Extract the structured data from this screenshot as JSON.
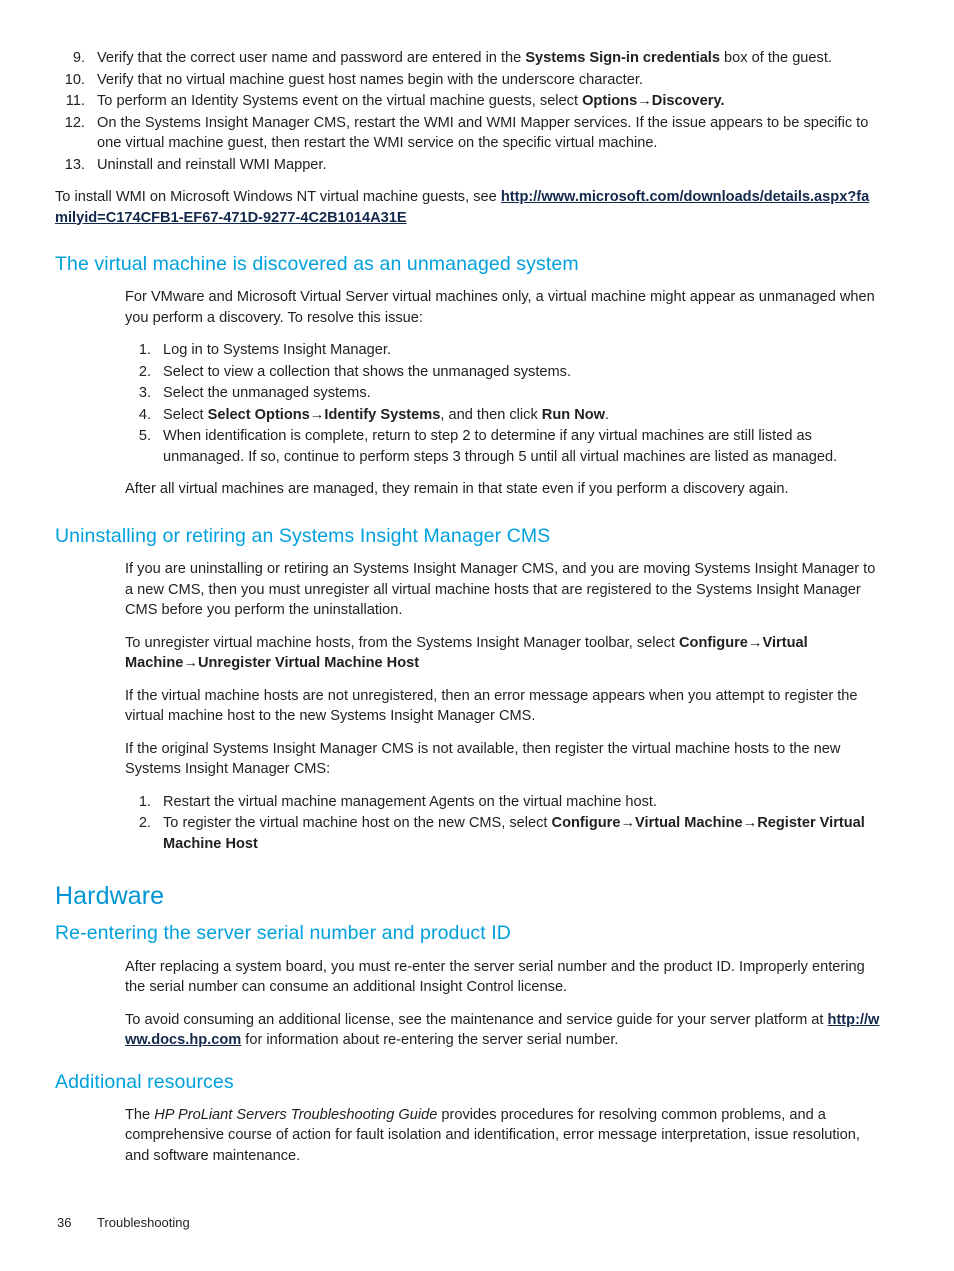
{
  "page": {
    "footer": {
      "page_number": "36",
      "chapter_label": "Troubleshooting"
    },
    "colors": {
      "heading_blue": "#0096D6",
      "subheading_blue": "#00A0DD",
      "link_navy": "#13294B",
      "body_text": "#231F20"
    }
  },
  "top_list": {
    "items": [
      {
        "num": "9.",
        "pre": "Verify that the correct user name and password are entered in the ",
        "bold": "Systems Sign-in credentials",
        "post": " box of the guest."
      },
      {
        "num": "10.",
        "pre": "Verify that no virtual machine guest host names begin with the underscore character.",
        "bold": "",
        "post": ""
      },
      {
        "num": "11.",
        "pre": "To perform an Identity Systems event on the virtual machine guests, select ",
        "bold": "Options→Discovery.",
        "post": ""
      },
      {
        "num": "12.",
        "pre": "On the Systems Insight Manager CMS, restart the WMI and WMI Mapper services. If the issue appears to be specific to one virtual machine guest, then restart the WMI service on the specific virtual machine.",
        "bold": "",
        "post": ""
      },
      {
        "num": "13.",
        "pre": "Uninstall and reinstall WMI Mapper.",
        "bold": "",
        "post": ""
      }
    ],
    "trailing_paragraph": {
      "pre": "To install WMI on Microsoft Windows NT virtual machine guests, see ",
      "link": "http://www.microsoft.com/downloads/details.aspx?familyid=C174CFB1-EF67-471D-9277-4C2B1014A31E"
    }
  },
  "section_unmanaged": {
    "heading": "The virtual machine is discovered as an unmanaged system",
    "intro": "For VMware and Microsoft Virtual Server virtual machines only, a virtual machine might appear as unmanaged when you perform a discovery. To resolve this issue:",
    "steps": [
      {
        "num": "1.",
        "pre": "Log in to Systems Insight Manager.",
        "bold": "",
        "mid": "",
        "bold2": "",
        "post": ""
      },
      {
        "num": "2.",
        "pre": "Select to view a collection that shows the unmanaged systems.",
        "bold": "",
        "mid": "",
        "bold2": "",
        "post": ""
      },
      {
        "num": "3.",
        "pre": "Select the unmanaged systems.",
        "bold": "",
        "mid": "",
        "bold2": "",
        "post": ""
      },
      {
        "num": "4.",
        "pre": "Select ",
        "bold": "Select Options→Identify Systems",
        "mid": ", and then click ",
        "bold2": "Run Now",
        "post": "."
      },
      {
        "num": "5.",
        "pre": "When identification is complete, return to step 2 to determine if any virtual machines are still listed as unmanaged. If so, continue to perform steps 3 through 5 until all virtual machines are listed as managed.",
        "bold": "",
        "mid": "",
        "bold2": "",
        "post": ""
      }
    ],
    "closing": "After all virtual machines are managed, they remain in that state even if you perform a discovery again."
  },
  "section_uninstall": {
    "heading": "Uninstalling or retiring an Systems Insight Manager CMS",
    "para1": "If you are uninstalling or retiring an Systems Insight Manager CMS, and you are moving Systems Insight Manager to a new CMS, then you must unregister all virtual machine hosts that are registered to the Systems Insight Manager CMS before you perform the uninstallation.",
    "para2_pre": "To unregister virtual machine hosts, from the Systems Insight Manager toolbar, select ",
    "para2_bold": "Configure→Virtual Machine→Unregister Virtual Machine Host",
    "para3": "If the virtual machine hosts are not unregistered, then an error message appears when you attempt to register the virtual machine host to the new Systems Insight Manager CMS.",
    "para4": "If the original Systems Insight Manager CMS is not available, then register the virtual machine hosts to the new Systems Insight Manager CMS:",
    "steps": [
      {
        "num": "1.",
        "pre": "Restart the virtual machine management Agents on the virtual machine host.",
        "bold": "",
        "post": ""
      },
      {
        "num": "2.",
        "pre": "To register the virtual machine host on the new CMS, select ",
        "bold": "Configure→Virtual Machine→Register Virtual Machine Host",
        "post": ""
      }
    ]
  },
  "section_hardware": {
    "heading": "Hardware",
    "sub_serial": {
      "heading": "Re-entering the server serial number and product ID",
      "para1": "After replacing a system board, you must re-enter the server serial number and the product ID. Improperly entering the serial number can consume an additional Insight Control license.",
      "para2_pre": "To avoid consuming an additional license, see the maintenance and service guide for your server platform at ",
      "para2_link": "http://www.docs.hp.com",
      "para2_post": " for information about re-entering the server serial number."
    },
    "sub_resources": {
      "heading": "Additional resources",
      "para_pre": "The ",
      "para_italic": "HP ProLiant Servers Troubleshooting Guide",
      "para_post": " provides procedures for resolving common problems, and a comprehensive course of action for fault isolation and identification, error message interpretation, issue resolution, and software maintenance."
    }
  }
}
